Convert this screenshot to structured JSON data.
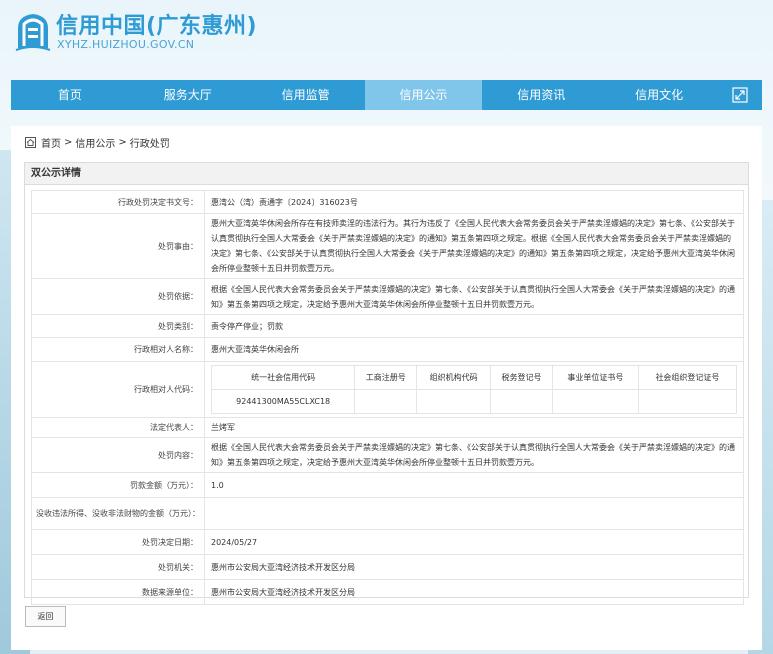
{
  "site": {
    "title": "信用中国(广东惠州)",
    "url": "XYHZ.HUIZHOU.GOV.CN"
  },
  "nav": {
    "items": [
      {
        "label": "首页"
      },
      {
        "label": "服务大厅"
      },
      {
        "label": "信用监管"
      },
      {
        "label": "信用公示",
        "active": true
      },
      {
        "label": "信用资讯"
      },
      {
        "label": "信用文化"
      }
    ],
    "expand_icon": "fullscreen-icon"
  },
  "breadcrumb": {
    "home": "首页",
    "sep": ">",
    "level1": "信用公示",
    "level2": "行政处罚"
  },
  "panel": {
    "title": "双公示详情"
  },
  "detail": {
    "doc_no": {
      "label": "行政处罚决定书文号：",
      "value": "惠湾公（湾）责通字〔2024〕316023号"
    },
    "facts": {
      "label": "处罚事由：",
      "value": "惠州大亚湾英华休闲会所存在有技师卖淫的违法行为。其行为违反了《全国人民代表大会常务委员会关于严禁卖淫嫖娼的决定》第七条、《公安部关于认真贯彻执行全国人大常委会《关于严禁卖淫嫖娼的决定》的通知》第五条第四项之规定。根据《全国人民代表大会常务委员会关于严禁卖淫嫖娼的决定》第七条、《公安部关于认真贯彻执行全国人大常委会《关于严禁卖淫嫖娼的决定》的通知》第五条第四项之规定，决定给予惠州大亚湾英华休闲会所停业整顿十五日并罚款壹万元。"
    },
    "basis": {
      "label": "处罚依据：",
      "value": "根据《全国人民代表大会常务委员会关于严禁卖淫嫖娼的决定》第七条、《公安部关于认真贯彻执行全国人大常委会《关于严禁卖淫嫖娼的决定》的通知》第五条第四项之规定，决定给予惠州大亚湾英华休闲会所停业整顿十五日并罚款壹万元。"
    },
    "category": {
      "label": "处罚类别：",
      "value": "责令停产停业；罚款"
    },
    "party_name": {
      "label": "行政相对人名称：",
      "value": "惠州大亚湾英华休闲会所"
    },
    "party_code": {
      "label": "行政相对人代码：",
      "headers": [
        "统一社会信用代码",
        "工商注册号",
        "组织机构代码",
        "税务登记号",
        "事业单位证书号",
        "社会组织登记证号"
      ],
      "values": [
        "92441300MA55CLXC18",
        "",
        "",
        "",
        "",
        ""
      ]
    },
    "legal_rep": {
      "label": "法定代表人：",
      "value": "兰烤军"
    },
    "content": {
      "label": "处罚内容：",
      "value": "根据《全国人民代表大会常务委员会关于严禁卖淫嫖娼的决定》第七条、《公安部关于认真贯彻执行全国人大常委会《关于严禁卖淫嫖娼的决定》的通知》第五条第四项之规定，决定给予惠州大亚湾英华休闲会所停业整顿十五日并罚款壹万元。"
    },
    "fine": {
      "label": "罚款金额（万元）：",
      "value": "1.0"
    },
    "confiscated": {
      "label": "没收违法所得、没收非法财物的金额（万元）：",
      "value": ""
    },
    "decision_date": {
      "label": "处罚决定日期：",
      "value": "2024/05/27"
    },
    "authority": {
      "label": "处罚机关：",
      "value": "惠州市公安局大亚湾经济技术开发区分局"
    },
    "source": {
      "label": "数据来源单位：",
      "value": "惠州市公安局大亚湾经济技术开发区分局"
    }
  },
  "buttons": {
    "back": "返回"
  },
  "colors": {
    "brand": "#2f9bd4",
    "nav_active": "#7fc6ea"
  }
}
